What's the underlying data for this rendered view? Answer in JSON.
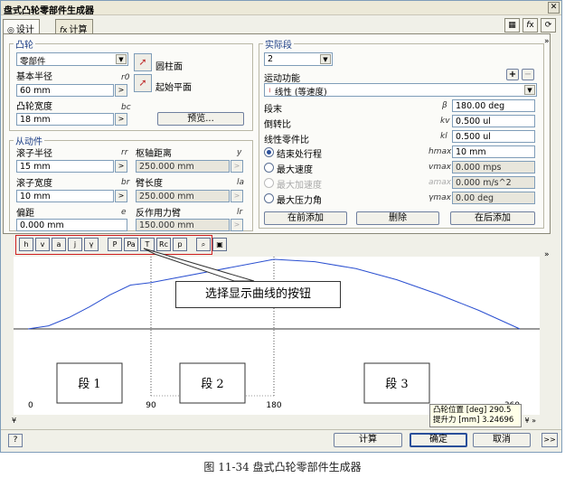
{
  "window": {
    "title": "盘式凸轮零部件生成器",
    "close_glyph": "✕"
  },
  "tabs": [
    {
      "label": "设计",
      "icon": "design-tab-icon"
    },
    {
      "label": "计算",
      "icon": "fx-calc-tab-icon"
    }
  ],
  "top_icons": [
    "table-icon",
    "fx-icon",
    "refresh-icon"
  ],
  "cam": {
    "legend": "凸轮",
    "component_type": "零部件",
    "cylinder_face": "圆柱面",
    "start_plane": "起始平面",
    "base_radius_label": "基本半径",
    "base_radius_sym": "r0",
    "base_radius": "60 mm",
    "cam_width_label": "凸轮宽度",
    "cam_width_sym": "bc",
    "cam_width": "18 mm",
    "preview": "预览..."
  },
  "follower": {
    "legend": "从动件",
    "roller_radius_label": "滚子半径",
    "roller_radius_sym": "rr",
    "roller_radius": "15 mm",
    "roller_width_label": "滚子宽度",
    "roller_width_sym": "br",
    "roller_width": "10 mm",
    "offset_label": "偏距",
    "offset_sym": "e",
    "offset": "0.000 mm",
    "axis_dist_label": "枢轴距离",
    "axis_dist_sym": "y",
    "axis_dist": "250.000 mm",
    "arm_len_label": "臂长度",
    "arm_len_sym": "la",
    "arm_len": "250.000 mm",
    "reaction_label": "反作用力臂",
    "reaction_sym": "lr",
    "reaction": "150.000 mm"
  },
  "segment": {
    "legend": "实际段",
    "index": "2",
    "motion_label": "运动功能",
    "motion_value": "线性 (等速度)",
    "end_label": "段末",
    "end_sym": "β",
    "end_value": "180.00 deg",
    "slope_label": "倒转比",
    "slope_sym": "kv",
    "slope_value": "0.500 ul",
    "linear_label": "线性零件比",
    "linear_sym": "kl",
    "linear_value": "0.500 ul",
    "opt_end_stroke": "结束处行程",
    "opt_end_stroke_sym": "hmax",
    "opt_end_stroke_val": "10 mm",
    "opt_max_vel": "最大速度",
    "opt_max_vel_sym": "vmax",
    "opt_max_vel_val": "0.000 mps",
    "opt_max_acc": "最大加速度",
    "opt_max_acc_sym": "amax",
    "opt_max_acc_val": "0.000 m/s^2",
    "opt_max_press": "最大压力角",
    "opt_max_press_sym": "γmax",
    "opt_max_press_val": "0.00 deg",
    "add_before": "在前添加",
    "delete": "删除",
    "add_after": "在后添加"
  },
  "curve_buttons": [
    "h",
    "v",
    "a",
    "j",
    "γ",
    "P",
    "Pa",
    "T",
    "Rc",
    "p"
  ],
  "annotation": "选择显示曲线的按钮",
  "chart_data": {
    "type": "line",
    "x_ticks": [
      "0",
      "90",
      "180",
      "360"
    ],
    "segments": [
      "段 1",
      "段 2",
      "段 3"
    ],
    "curve": [
      [
        0,
        0
      ],
      [
        15,
        1.34
      ],
      [
        30,
        4.9
      ],
      [
        45,
        9.5
      ],
      [
        60,
        14.7
      ],
      [
        75,
        18.9
      ],
      [
        90,
        20
      ],
      [
        180,
        30
      ],
      [
        210,
        29.0
      ],
      [
        240,
        26.0
      ],
      [
        270,
        21.2
      ],
      [
        300,
        15.0
      ],
      [
        330,
        8.0
      ],
      [
        360,
        0
      ]
    ],
    "readout_cam_label": "凸轮位置 [deg]",
    "readout_cam_value": "290.5",
    "readout_lift_label": "提升力 [mm]",
    "readout_lift_value": "3.24696"
  },
  "bottom": {
    "help": "?",
    "calc": "计算",
    "ok": "确定",
    "cancel": "取消",
    "more": ">>"
  },
  "caption": "图 11-34   盘式凸轮零部件生成器"
}
